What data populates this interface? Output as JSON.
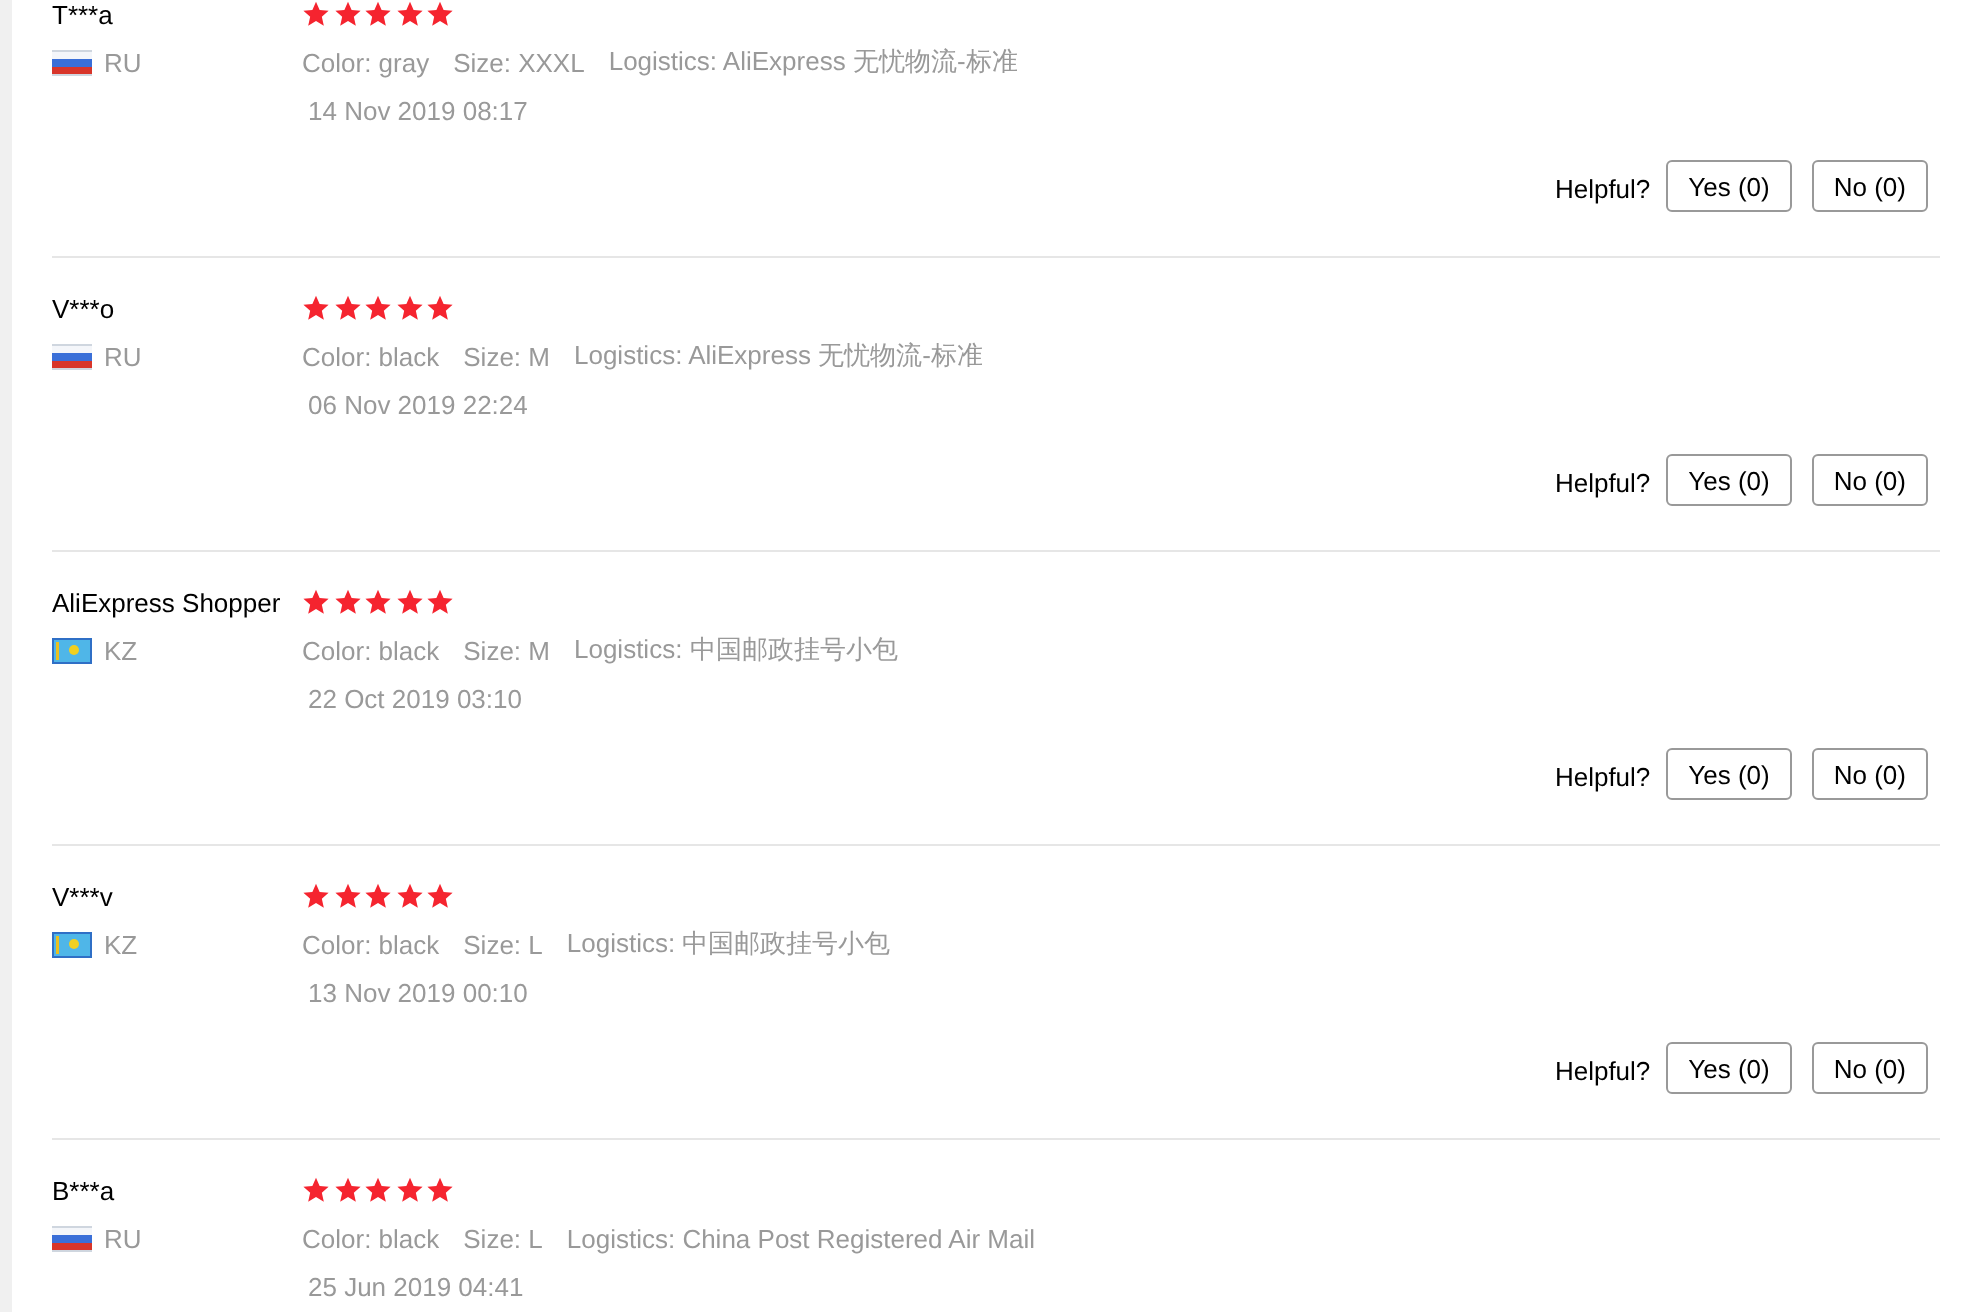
{
  "reviews": [
    {
      "name": "T***a",
      "kind": "ru",
      "country": "RU",
      "stars": 5,
      "variant": "Color: gray",
      "size": "Size: XXXL",
      "logistics": "Logistics: AliExpress 无忧物流-标准",
      "date": "14 Nov 2019 08:17",
      "helpful": "Helpful?",
      "yes": "Yes (0)",
      "no": "No (0)"
    },
    {
      "name": "V***o",
      "kind": "ru",
      "country": "RU",
      "stars": 5,
      "variant": "Color: black",
      "size": "Size: M",
      "logistics": "Logistics: AliExpress 无忧物流-标准",
      "date": "06 Nov 2019 22:24",
      "helpful": "Helpful?",
      "yes": "Yes (0)",
      "no": "No (0)"
    },
    {
      "name": "AliExpress Shopper",
      "kind": "kz",
      "country": "KZ",
      "stars": 5,
      "variant": "Color: black",
      "size": "Size: M",
      "logistics": "Logistics: 中国邮政挂号小包",
      "date": "22 Oct 2019 03:10",
      "helpful": "Helpful?",
      "yes": "Yes (0)",
      "no": "No (0)"
    },
    {
      "name": "V***v",
      "kind": "kz",
      "country": "KZ",
      "stars": 5,
      "variant": "Color: black",
      "size": "Size: L",
      "logistics": "Logistics: 中国邮政挂号小包",
      "date": "13 Nov 2019 00:10",
      "helpful": "Helpful?",
      "yes": "Yes (0)",
      "no": "No (0)"
    },
    {
      "name": "B***a",
      "kind": "ru",
      "country": "RU",
      "stars": 5,
      "variant": "Color: black",
      "size": "Size: L",
      "logistics": "Logistics: China Post Registered Air Mail",
      "date": "25 Jun 2019 04:41"
    }
  ]
}
